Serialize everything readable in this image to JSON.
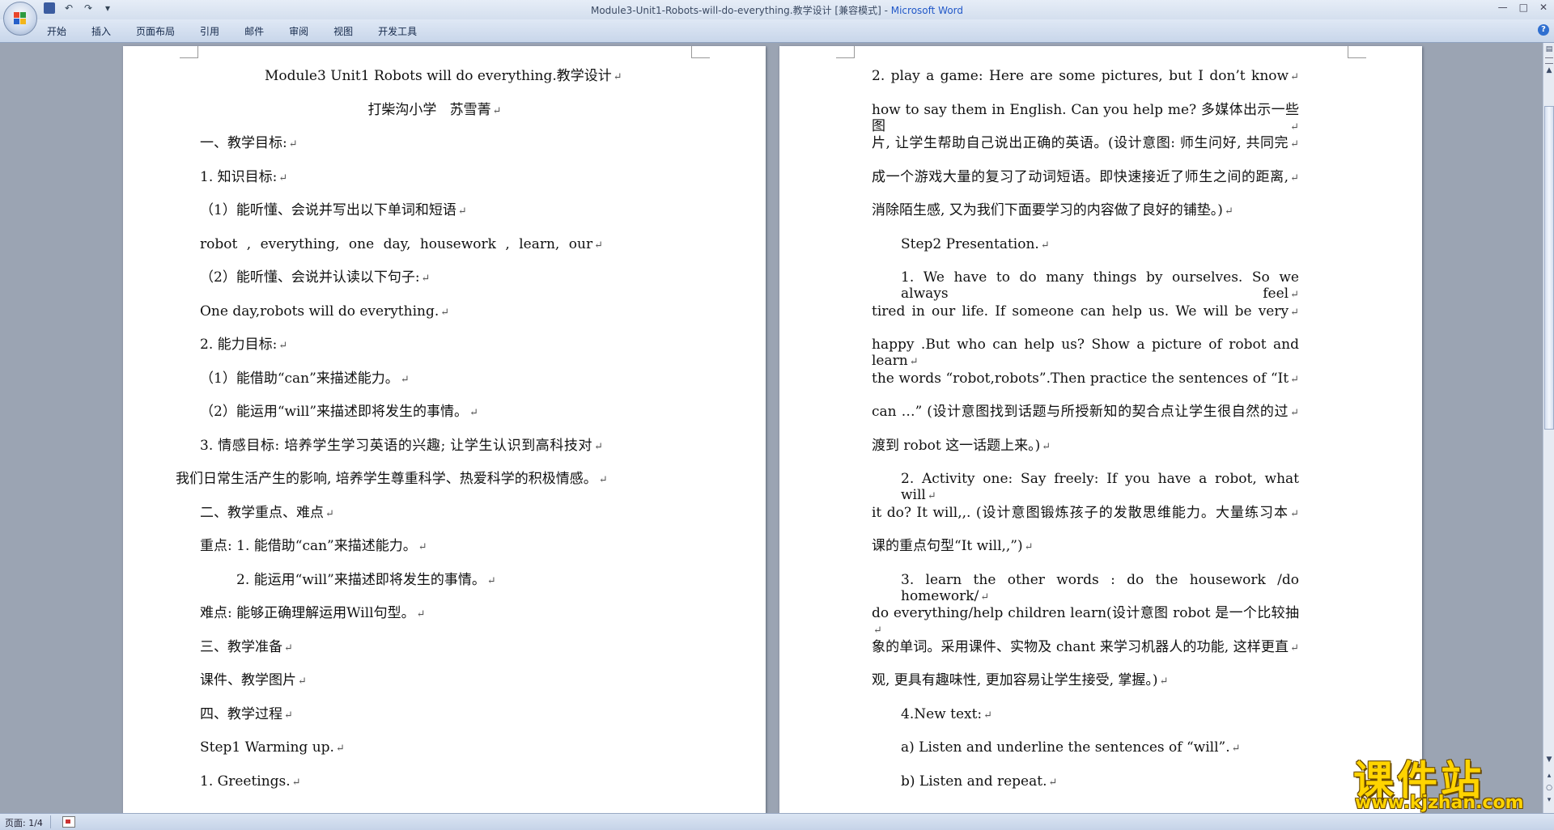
{
  "window": {
    "title_doc": "Module3-Unit1-Robots-will-do-everything.教学设计 [兼容模式] - ",
    "title_app": "Microsoft Word"
  },
  "qat": {
    "save": "save-icon",
    "undo": "↶",
    "redo": "↷",
    "dropdown": "▾"
  },
  "ribbon": {
    "tabs": [
      "开始",
      "插入",
      "页面布局",
      "引用",
      "邮件",
      "审阅",
      "视图",
      "开发工具"
    ]
  },
  "colors": {
    "title_app": "#2158c8",
    "workspace_bg": "#9ba4b3",
    "watermark_yellow": "#ffd400"
  },
  "pages": {
    "left": [
      "Module3 Unit1 Robots will do everything.教学设计",
      "打柴沟小学   苏雪菁",
      "一、教学目标:",
      "1. 知识目标:",
      "（1）能听懂、会说并写出以下单词和短语",
      "robot , everything, one day, housework , learn, our",
      "（2）能听懂、会说并认读以下句子:",
      "One day,robots will do everything.",
      "2. 能力目标:",
      "（1）能借助“can”来描述能力。",
      "（2）能运用“will”来描述即将发生的事情。",
      "3. 情感目标: 培养学生学习英语的兴趣; 让学生认识到高科技对",
      "我们日常生活产生的影响, 培养学生尊重科学、热爱科学的积极情感。",
      "二、教学重点、难点",
      "重点: 1. 能借助“can”来描述能力。",
      "2. 能运用“will”来描述即将发生的事情。",
      "难点: 能够正确理解运用Will句型。",
      "三、教学准备",
      "课件、教学图片",
      "四、教学过程",
      "Step1 Warming up.",
      "1. Greetings."
    ],
    "right": [
      "2. play a game: Here are some pictures, but I don’t know",
      "how to say them in English. Can you help me? 多媒体出示一些图",
      "片, 让学生帮助自己说出正确的英语。(设计意图: 师生问好, 共同完",
      "成一个游戏大量的复习了动词短语。即快速接近了师生之间的距离,",
      "消除陌生感, 又为我们下面要学习的内容做了良好的铺垫。)",
      "Step2 Presentation.",
      "1. We have to do many things by ourselves. So we always feel",
      "tired in our life. If someone can help us. We will be very",
      "happy .But who can help us? Show a picture of robot and learn",
      "the words “robot,robots”.Then practice the sentences of “It",
      "can …” (设计意图找到话题与所授新知的契合点让学生很自然的过",
      "渡到 robot 这一话题上来。)",
      "2. Activity one:   Say freely: If you have a robot, what will",
      "it do? It will,,.  (设计意图锻炼孩子的发散思维能力。大量练习本",
      "课的重点句型“It will,,”)",
      "3. learn the other words : do the housework /do homework/",
      "do everything/help children learn(设计意图 robot 是一个比较抽",
      "象的单词。采用课件、实物及 chant 来学习机器人的功能, 这样更直",
      "观, 更具有趣味性, 更加容易让学生接受, 掌握。)",
      "4.New text:",
      "a) Listen and underline the sentences of “will”.",
      "b) Listen and repeat."
    ]
  },
  "status": {
    "page": "页面: 1/4"
  },
  "watermark": {
    "main": "课件站",
    "url": "www.kjzhan.com"
  }
}
